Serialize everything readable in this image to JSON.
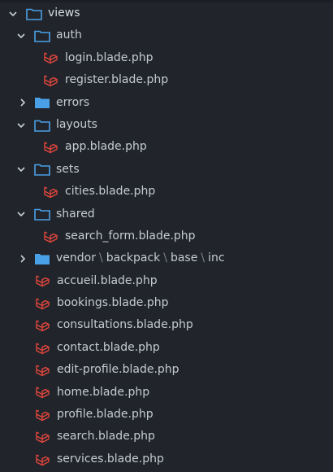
{
  "tree": {
    "root": {
      "label": "views",
      "expanded": true,
      "icon": "folder-open-icon"
    },
    "auth": {
      "label": "auth",
      "expanded": true,
      "icon": "folder-open-icon",
      "files": [
        "login.blade.php",
        "register.blade.php"
      ]
    },
    "errors": {
      "label": "errors",
      "expanded": false,
      "icon": "folder-icon"
    },
    "layouts": {
      "label": "layouts",
      "expanded": true,
      "icon": "folder-open-icon",
      "files": [
        "app.blade.php"
      ]
    },
    "sets": {
      "label": "sets",
      "expanded": true,
      "icon": "folder-open-icon",
      "files": [
        "cities.blade.php"
      ]
    },
    "shared": {
      "label": "shared",
      "expanded": true,
      "icon": "folder-open-icon",
      "files": [
        "search_form.blade.php"
      ]
    },
    "vendor": {
      "parts": [
        "vendor",
        "backpack",
        "base",
        "inc"
      ],
      "separator": "\\",
      "expanded": false,
      "icon": "folder-icon"
    },
    "root_files": [
      "accueil.blade.php",
      "bookings.blade.php",
      "consultations.blade.php",
      "contact.blade.php",
      "edit-profile.blade.php",
      "home.blade.php",
      "profile.blade.php",
      "search.blade.php",
      "services.blade.php"
    ]
  },
  "colors": {
    "background": "#21252b",
    "folder_open": "#4aa0e6",
    "folder_closed": "#4aa0e6",
    "laravel": "#e0453c",
    "chevron": "#c9ced6"
  }
}
